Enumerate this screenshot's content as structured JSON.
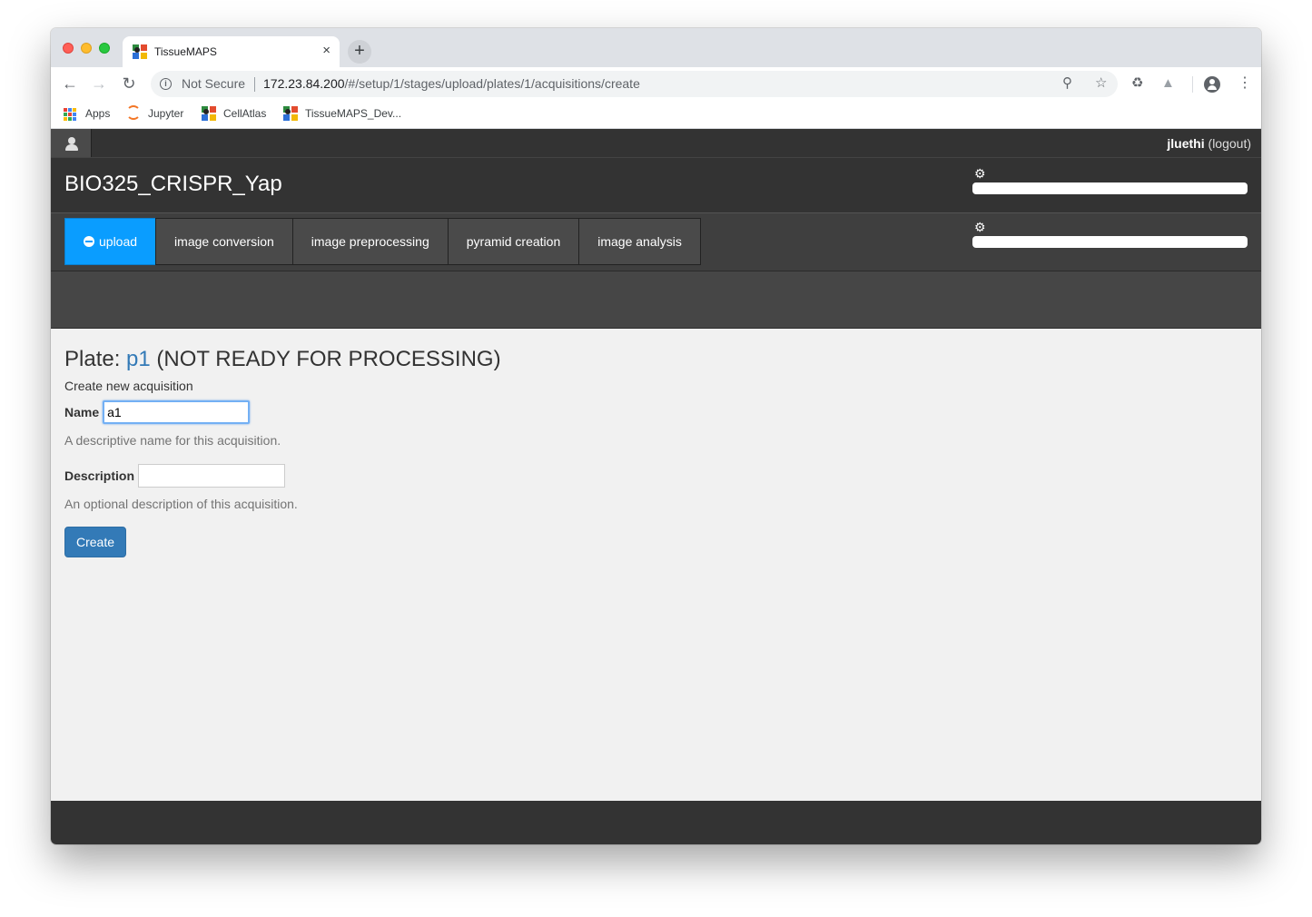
{
  "browser": {
    "tab_title": "TissueMAPS",
    "tab_close": "×",
    "new_tab": "+",
    "security_label": "Not Secure",
    "url_host": "172.23.84.200",
    "url_path": "/#/setup/1/stages/upload/plates/1/acquisitions/create",
    "bookmarks": [
      {
        "label": "Apps",
        "icon": "apps-grid-icon"
      },
      {
        "label": "Jupyter",
        "icon": "jupyter-icon"
      },
      {
        "label": "CellAtlas",
        "icon": "tissuemaps-icon"
      },
      {
        "label": "TissueMAPS_Dev..."
      }
    ]
  },
  "app": {
    "user": {
      "name": "jluethi",
      "logout_label": "(logout)"
    },
    "experiment_title": "BIO325_CRISPR_Yap",
    "stages": [
      {
        "label": "upload",
        "active": true
      },
      {
        "label": "image conversion"
      },
      {
        "label": "image preprocessing"
      },
      {
        "label": "pyramid creation"
      },
      {
        "label": "image analysis"
      }
    ],
    "plate": {
      "prefix": "Plate: ",
      "name": "p1",
      "status": " (NOT READY FOR PROCESSING)"
    },
    "form": {
      "subtitle": "Create new acquisition",
      "name_label": "Name",
      "name_value": "a1",
      "name_help": "A descriptive name for this acquisition.",
      "description_label": "Description",
      "description_value": "",
      "description_help": "An optional description of this acquisition.",
      "submit_label": "Create"
    }
  },
  "colors": {
    "accent": "#0a9dff",
    "primary_button": "#337ab7",
    "navbar": "#333333"
  }
}
